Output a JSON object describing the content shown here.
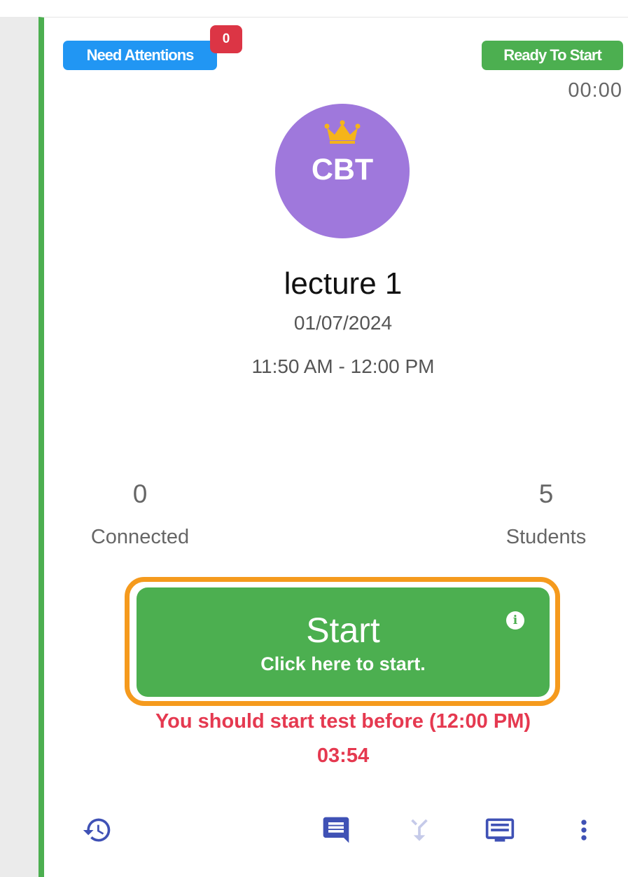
{
  "card": {
    "attention_badge": "Need Attentions",
    "attention_count": "0",
    "status_badge": "Ready To Start",
    "timer": "00:00",
    "avatar_text": "CBT",
    "title": "lecture 1",
    "date": "01/07/2024",
    "time_range": "11:50 AM - 12:00 PM",
    "connected_count": "0",
    "connected_label": "Connected",
    "students_count": "5",
    "students_label": "Students",
    "start_button": {
      "label": "Start",
      "sublabel": "Click here to start."
    },
    "warning": "You should start test before (12:00 PM)",
    "countdown": "03:54"
  },
  "icons": {
    "avatar_badge": "crown-icon",
    "start_info": "info-icon",
    "footer": [
      "history-icon",
      "chat-icon",
      "merge-icon",
      "message-list-icon",
      "more-vertical-icon"
    ]
  },
  "colors": {
    "accent_green": "#4caf50",
    "info_blue": "#2196f3",
    "alert_red": "#dc3545",
    "warning_text": "#e53950",
    "highlight_orange": "#f59a1d",
    "avatar_purple": "#9f78dc",
    "icon_indigo": "#3f51b5",
    "crown_gold": "#f5b41a"
  }
}
